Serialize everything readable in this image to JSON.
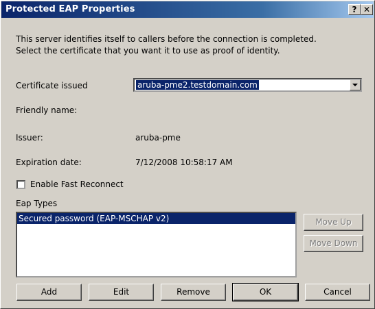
{
  "window": {
    "title": "Protected EAP Properties",
    "help_glyph": "?",
    "close_glyph": "✕"
  },
  "intro": {
    "line1": "This server identifies itself to callers before the connection is completed.",
    "line2": "Select the certificate that you want it to use as proof of identity."
  },
  "certificate": {
    "label": "Certificate issued",
    "selected": "aruba-pme2.testdomain.com"
  },
  "details": {
    "friendly_name_label": "Friendly name:",
    "friendly_name_value": "",
    "issuer_label": "Issuer:",
    "issuer_value": "aruba-pme",
    "expiration_label": "Expiration date:",
    "expiration_value": "7/12/2008 10:58:17 AM"
  },
  "fast_reconnect": {
    "label": "Enable Fast Reconnect",
    "checked": false
  },
  "eap_types": {
    "label": "Eap Types",
    "items": [
      "Secured password (EAP-MSCHAP v2)"
    ]
  },
  "buttons": {
    "move_up": "Move Up",
    "move_down": "Move Down",
    "add": "Add",
    "edit": "Edit",
    "remove": "Remove",
    "ok": "OK",
    "cancel": "Cancel"
  }
}
